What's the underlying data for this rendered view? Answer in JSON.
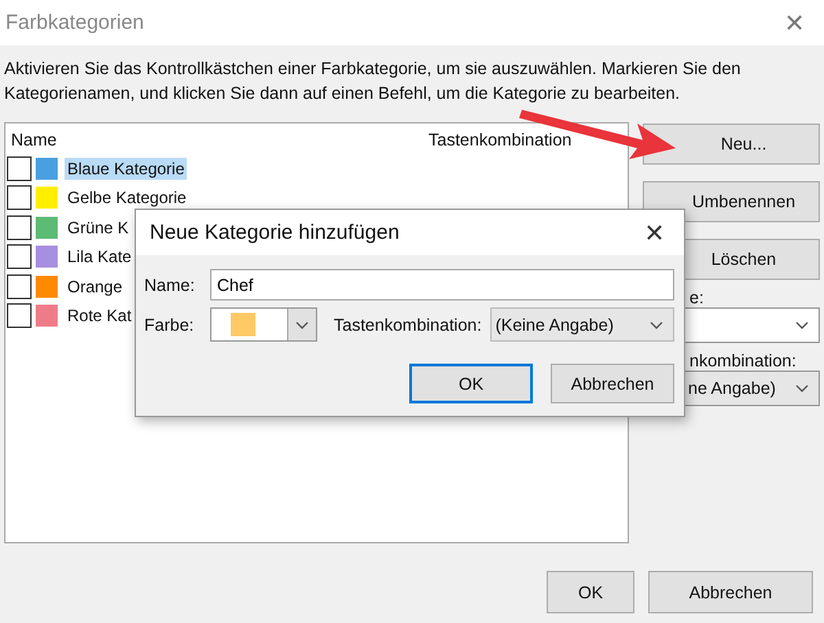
{
  "window": {
    "title": "Farbkategorien",
    "close": "✕"
  },
  "instruction": "Aktivieren Sie das Kontrollkästchen einer Farbkategorie, um sie auszuwählen. Markieren Sie den Kategorienamen, und klicken Sie dann auf einen Befehl, um die Kategorie zu bearbeiten.",
  "table": {
    "columns": [
      "Name",
      "Tastenkombination"
    ],
    "rows": [
      {
        "name": "Blaue Kategorie",
        "color": "#4a9fe0",
        "checked": false,
        "selected": true
      },
      {
        "name": "Gelbe Kategorie",
        "color": "#ffee00",
        "checked": false,
        "selected": false
      },
      {
        "name": "Grüne K",
        "color": "#5cbb74",
        "checked": false,
        "selected": false
      },
      {
        "name": "Lila Kate",
        "color": "#a68ee0",
        "checked": false,
        "selected": false
      },
      {
        "name": "Orange",
        "color": "#ff8a00",
        "checked": false,
        "selected": false
      },
      {
        "name": "Rote Kat",
        "color": "#ee7c88",
        "checked": false,
        "selected": false
      }
    ]
  },
  "side_buttons": [
    "Neu...",
    "Umbenennen",
    "Löschen"
  ],
  "side_fields": [
    {
      "label": "e:"
    },
    {
      "label": "nkombination:",
      "value": "ne Angabe)"
    }
  ],
  "buttons": [
    "OK",
    "Abbrechen"
  ],
  "dialog": {
    "title": "Neue Kategorie hinzufügen",
    "close": "✕",
    "name_label": "Name:",
    "name_value": "Chef",
    "color_label": "Farbe:",
    "color": "#ffc966",
    "shortcut_label": "Tastenkombination:",
    "shortcut_value": "(Keine Angabe)",
    "buttons": [
      {
        "label": "OK",
        "selected": true
      },
      {
        "label": "Abbrechen",
        "selected": false
      }
    ]
  }
}
